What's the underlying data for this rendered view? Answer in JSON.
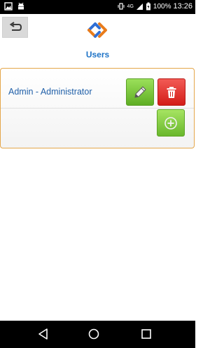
{
  "status_bar": {
    "network": "4G",
    "battery": "100%",
    "time": "13:26"
  },
  "header": {
    "back_icon": "back-arrow-icon",
    "logo": "app-logo",
    "title": "Users"
  },
  "users": [
    {
      "label": "Admin - Administrator",
      "edit_icon": "pencil-icon",
      "delete_icon": "trash-icon"
    }
  ],
  "actions": {
    "add_icon": "plus-circle-icon"
  },
  "colors": {
    "title": "#1e73c7",
    "user_text": "#1f5fa8",
    "panel_border": "#e4a64a",
    "edit_button": "#7cc83e",
    "delete_button": "#e2322d",
    "add_button": "#86cc44"
  }
}
